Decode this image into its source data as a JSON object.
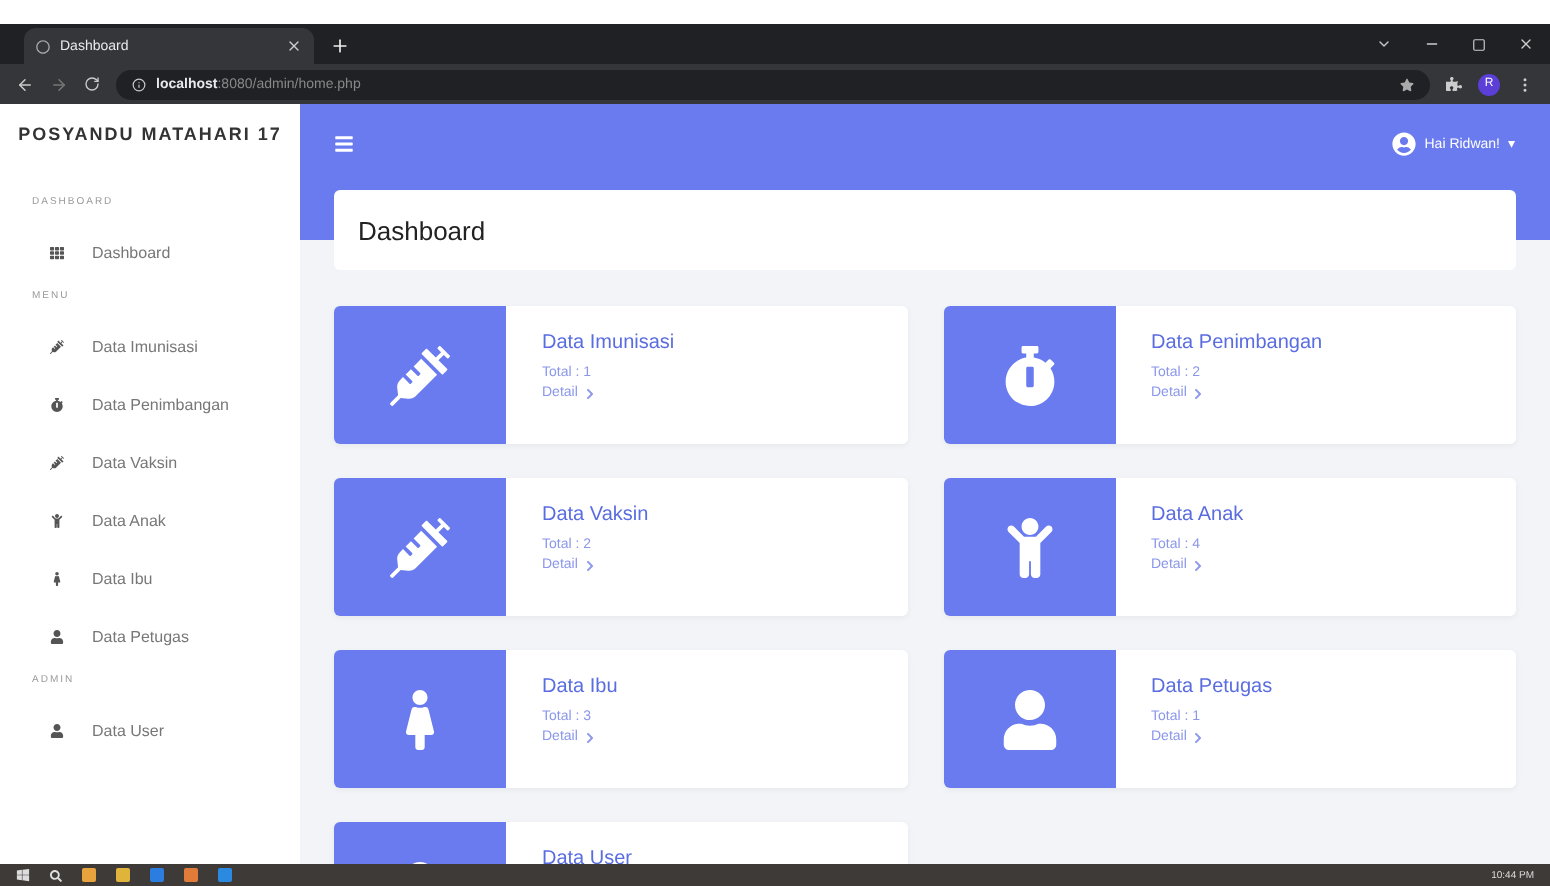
{
  "browser": {
    "tab_title": "Dashboard",
    "url_host": "localhost",
    "url_path": ":8080/admin/home.php",
    "profile_initial": "R"
  },
  "sidebar": {
    "brand": "POSYANDU MATAHARI 17",
    "sections": [
      {
        "heading": "DASHBOARD",
        "items": [
          {
            "label": "Dashboard",
            "kind": "grid"
          }
        ]
      },
      {
        "heading": "MENU",
        "items": [
          {
            "label": "Data Imunisasi",
            "kind": "syringe"
          },
          {
            "label": "Data Penimbangan",
            "kind": "stopwatch"
          },
          {
            "label": "Data Vaksin",
            "kind": "syringe"
          },
          {
            "label": "Data Anak",
            "kind": "child"
          },
          {
            "label": "Data Ibu",
            "kind": "female"
          },
          {
            "label": "Data Petugas",
            "kind": "user"
          }
        ]
      },
      {
        "heading": "ADMIN",
        "items": [
          {
            "label": "Data User",
            "kind": "user"
          }
        ]
      }
    ]
  },
  "topbar": {
    "user": "Hai Ridwan!",
    "caret": "▾"
  },
  "page_title": "Dashboard",
  "cards": [
    {
      "title": "Data Imunisasi",
      "total": "Total : 1",
      "link": "Detail",
      "kind": "syringe"
    },
    {
      "title": "Data Penimbangan",
      "total": "Total : 2",
      "link": "Detail",
      "kind": "stopwatch"
    },
    {
      "title": "Data Vaksin",
      "total": "Total : 2",
      "link": "Detail",
      "kind": "syringe"
    },
    {
      "title": "Data Anak",
      "total": "Total : 4",
      "link": "Detail",
      "kind": "child"
    },
    {
      "title": "Data Ibu",
      "total": "Total : 3",
      "link": "Detail",
      "kind": "female"
    },
    {
      "title": "Data Petugas",
      "total": "Total : 1",
      "link": "Detail",
      "kind": "user"
    },
    {
      "title": "Data User",
      "kind": "user"
    }
  ],
  "taskbar": {
    "time": "10:44 PM"
  }
}
